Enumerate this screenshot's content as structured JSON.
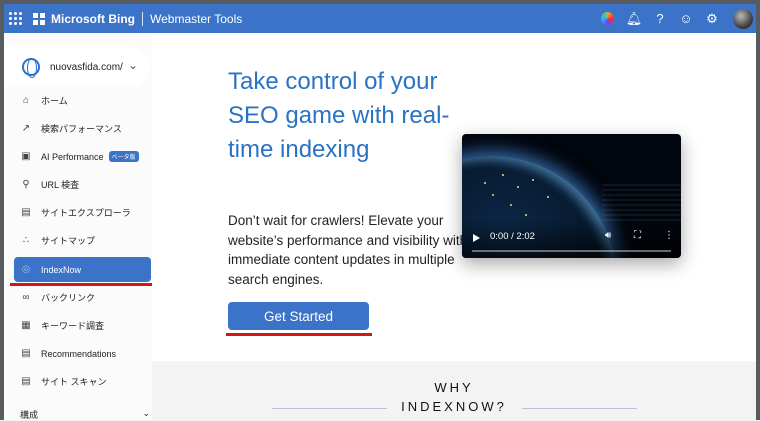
{
  "topbar": {
    "brand": "Microsoft Bing",
    "product": "Webmaster Tools"
  },
  "site": {
    "name": "nuovasfida.com/"
  },
  "nav": [
    {
      "label": "ホーム",
      "icon": "home-icon"
    },
    {
      "label": "検索パフォーマンス",
      "icon": "trend-icon"
    },
    {
      "label": "AI Performance",
      "icon": "image-icon",
      "badge": "ベータ版"
    },
    {
      "label": "URL 検査",
      "icon": "search-icon"
    },
    {
      "label": "サイトエクスプローラ",
      "icon": "document-icon"
    },
    {
      "label": "サイトマップ",
      "icon": "sitemap-icon"
    },
    {
      "label": "IndexNow",
      "icon": "indexnow-icon"
    },
    {
      "label": "バックリンク",
      "icon": "link-icon"
    },
    {
      "label": "キーワード調査",
      "icon": "keyword-icon"
    },
    {
      "label": "Recommendations",
      "icon": "recommend-icon"
    },
    {
      "label": "サイト スキャン",
      "icon": "scan-icon"
    }
  ],
  "section": {
    "label": "構成"
  },
  "hero": {
    "title": "Take control of your SEO game with real-time indexing",
    "description": "Don’t wait for crawlers! Elevate your website’s performance and visibility with immediate content updates in multiple search engines.",
    "cta": "Get Started"
  },
  "video": {
    "time": "0:00 / 2:02",
    "progress": 0
  },
  "why": {
    "line1": "WHY",
    "line2": "INDEXNOW?"
  },
  "colors": {
    "accent": "#3b73c9",
    "highlight": "#d01818",
    "title": "#2a72c4"
  }
}
